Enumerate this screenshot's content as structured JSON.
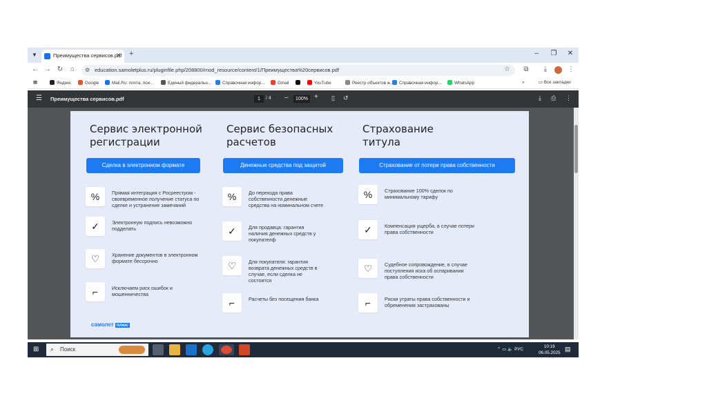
{
  "browser": {
    "tab_title": "Преимущества сервисов.pdf",
    "url": "education.samoletplus.ru/pluginfile.php/208800/mod_resource/content/1/Преимущества%20сервисов.pdf",
    "bookmarks": [
      {
        "label": "Яндекс",
        "color": "#222222"
      },
      {
        "label": "Google",
        "color": "#e4572e"
      },
      {
        "label": "Mail.Ru: почта, пои...",
        "color": "#1a73e8"
      },
      {
        "label": "Единый федеральн...",
        "color": "#555555"
      },
      {
        "label": "Справочная инфор...",
        "color": "#2a7de1"
      },
      {
        "label": "Gmail",
        "color": "#ea4335"
      },
      {
        "label": "",
        "color": "#111111"
      },
      {
        "label": "YouTube",
        "color": "#ff0000"
      },
      {
        "label": "Реестр объектов ж...",
        "color": "#888888"
      },
      {
        "label": "Справочная инфор...",
        "color": "#2a7de1"
      },
      {
        "label": "WhatsApp",
        "color": "#25d366"
      }
    ],
    "all_bookmarks_label": "Все закладки"
  },
  "pdf": {
    "title": "Преимущества сервисов.pdf",
    "current_page": "1",
    "total_pages": "/ 4",
    "zoom": "100%"
  },
  "slide": {
    "columns": [
      {
        "title_line1": "Сервис электронной",
        "title_line2": "регистрации",
        "button": "Сделка в электронном формате",
        "features": [
          {
            "icon": "percent-icon",
            "glyph": "%",
            "text": "Прямая интеграция с Росреестром - своевременное получение статуса по сделке и устранение замечаний"
          },
          {
            "icon": "check-icon",
            "glyph": "✓",
            "text": "Электронную подпись невозможно подделать"
          },
          {
            "icon": "heart-icon",
            "glyph": "♡",
            "text": "Хранение документов в электронном формате бессрочно"
          },
          {
            "icon": "stairs-icon",
            "glyph": "⌐",
            "text": "Исключаем риск ошибок и мошенничества"
          }
        ]
      },
      {
        "title_line1": "Сервис безопасных",
        "title_line2": "расчетов",
        "button": "Денежные средства под защитой",
        "features": [
          {
            "icon": "percent-icon",
            "glyph": "%",
            "text": "До перехода права собственности денежные средства на номинальном счете"
          },
          {
            "icon": "check-icon",
            "glyph": "✓",
            "text": "Для продавца: гарантия наличия денежных средств у покупателф"
          },
          {
            "icon": "heart-icon",
            "glyph": "♡",
            "text": "Для покупателя: гарантия возврата денежных средств в случае, если сделка не состоится"
          },
          {
            "icon": "stairs-icon",
            "glyph": "⌐",
            "text": "Расчеты без посещения банка"
          }
        ]
      },
      {
        "title_line1": "Страхование",
        "title_line2": "титула",
        "button": "Страхование от потери права собственности",
        "features": [
          {
            "icon": "percent-icon",
            "glyph": "%",
            "text": "Страхование 100% сделок по минимальному тарифу"
          },
          {
            "icon": "check-icon",
            "glyph": "✓",
            "text": "Компенсация ущерба, в случае потери права собственности"
          },
          {
            "icon": "heart-icon",
            "glyph": "♡",
            "text": "Судебное сопровождение, в случае поступления иска об оспаривании права собственности"
          },
          {
            "icon": "stairs-icon",
            "glyph": "⌐",
            "text": "Риски утраты права собственности и обременения застрахованы"
          }
        ]
      }
    ],
    "brand": "самолет",
    "brand_plus": "плюс"
  },
  "taskbar": {
    "search_placeholder": "Поиск",
    "language": "РУС",
    "time": "10:19",
    "date": "06.05.2025"
  }
}
